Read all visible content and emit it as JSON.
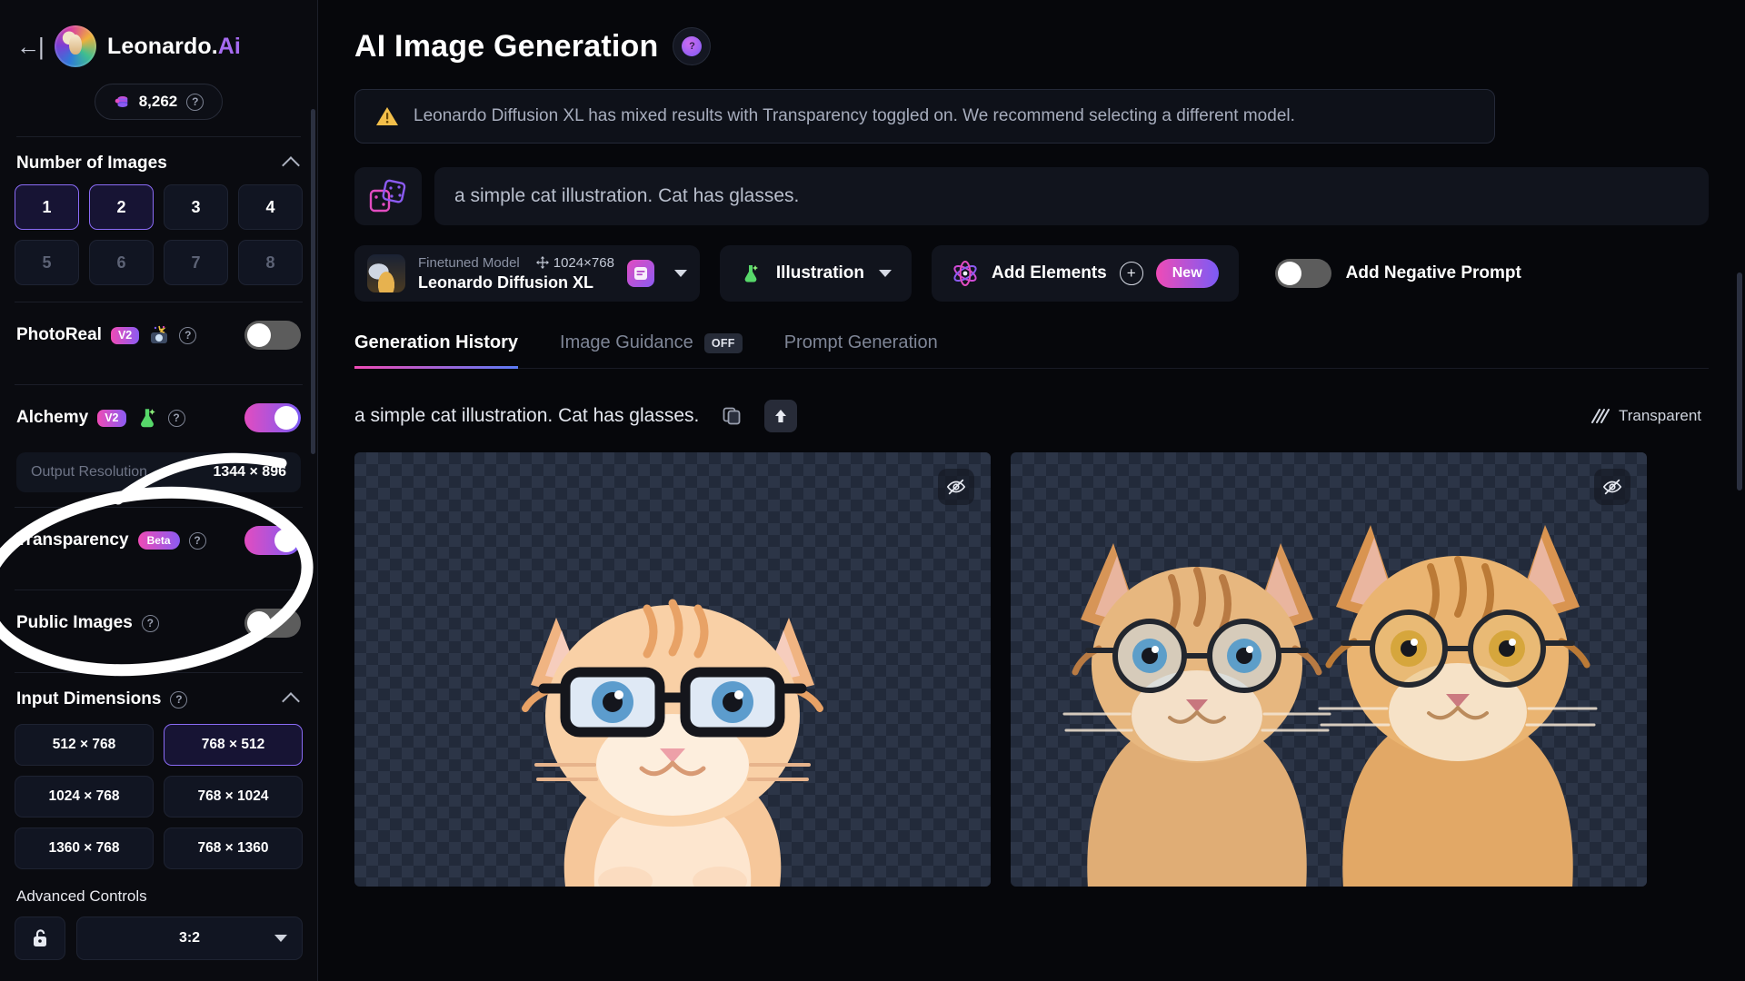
{
  "sidebar": {
    "back_icon": "arrow-left-icon",
    "brand": {
      "name": "Leonardo.",
      "suffix": "Ai"
    },
    "credits": {
      "icon": "coin-stack-icon",
      "value": "8,262",
      "help": "?"
    },
    "number_of_images": {
      "title": "Number of Images",
      "collapse_icon": "chevron-up-icon",
      "options": [
        "1",
        "2",
        "3",
        "4",
        "5",
        "6",
        "7",
        "8"
      ],
      "selected": "2",
      "disabled": [
        "5",
        "6",
        "7",
        "8"
      ]
    },
    "photoreal": {
      "label": "PhotoReal",
      "badge": "V2",
      "icon": "camera-flash-icon",
      "help": "?",
      "enabled": false
    },
    "alchemy": {
      "label": "Alchemy",
      "badge": "V2",
      "icon": "potion-flask-icon",
      "help": "?",
      "enabled": true
    },
    "output_resolution": {
      "label": "Output Resolution",
      "value": "1344 × 896"
    },
    "transparency": {
      "label": "Transparency",
      "badge": "Beta",
      "help": "?",
      "enabled": true
    },
    "public_images": {
      "label": "Public Images",
      "help": "?",
      "enabled": false
    },
    "input_dimensions": {
      "title": "Input Dimensions",
      "help": "?",
      "collapse_icon": "chevron-up-icon",
      "options": [
        "512 × 768",
        "768 × 512",
        "1024 × 768",
        "768 × 1024",
        "1360 × 768",
        "768 × 1360"
      ],
      "selected": "768 × 512"
    },
    "advanced_controls": {
      "title": "Advanced Controls",
      "lock_icon": "unlock-icon",
      "ratio": "3:2",
      "caret_icon": "caret-down-icon"
    }
  },
  "main": {
    "page_title": "AI Image Generation",
    "title_help_icon": "help-circle-icon",
    "warning": {
      "icon": "warning-triangle-icon",
      "text": "Leonardo Diffusion XL has mixed results with Transparency toggled on. We recommend selecting a different model."
    },
    "prompt": {
      "dice_icon": "dice-icon",
      "value": "a simple cat illustration. Cat has glasses."
    },
    "controls": {
      "model": {
        "kind_label": "Finetuned Model",
        "move_icon": "move-arrows-icon",
        "dimensions": "1024×768",
        "name": "Leonardo Diffusion XL",
        "preset_icon": "preset-card-icon",
        "caret_icon": "caret-down-icon"
      },
      "style": {
        "icon": "potion-flask-icon",
        "label": "Illustration",
        "caret_icon": "caret-down-icon"
      },
      "elements": {
        "icon": "atom-icon",
        "label": "Add Elements",
        "plus_icon": "plus-circle-icon",
        "badge": "New"
      },
      "negative_prompt": {
        "label": "Add Negative Prompt",
        "enabled": false
      }
    },
    "tabs": [
      {
        "label": "Generation History",
        "active": true
      },
      {
        "label": "Image Guidance",
        "active": false,
        "badge": "OFF"
      },
      {
        "label": "Prompt Generation",
        "active": false
      }
    ],
    "generation": {
      "prompt_text": "a simple cat illustration. Cat has glasses.",
      "copy_icon": "copy-icon",
      "upload_icon": "arrow-up-icon",
      "transparent_label": "Transparent",
      "transparent_icon": "transparency-hatch-icon",
      "images": [
        {
          "name": "generated-image-1",
          "alt": "orange cat illustration with black rectangular glasses on transparent checkerboard",
          "eye_icon": "eye-off-icon"
        },
        {
          "name": "generated-image-2",
          "alt": "two orange tabby cats wearing round glasses on transparent checkerboard",
          "eye_icon": "eye-off-icon"
        }
      ]
    }
  },
  "annotation": {
    "shape": "white-ellipse-highlight",
    "targets": [
      "Transparency",
      "Public Images"
    ]
  },
  "colors": {
    "background": "#06070b",
    "sidebar": "#0a0b10",
    "accent_purple": "#8a6bf5",
    "accent_pink": "#ef4bb6",
    "panel": "#11141d",
    "muted_text": "#8a91a3",
    "warning_amber": "#f0b840"
  }
}
